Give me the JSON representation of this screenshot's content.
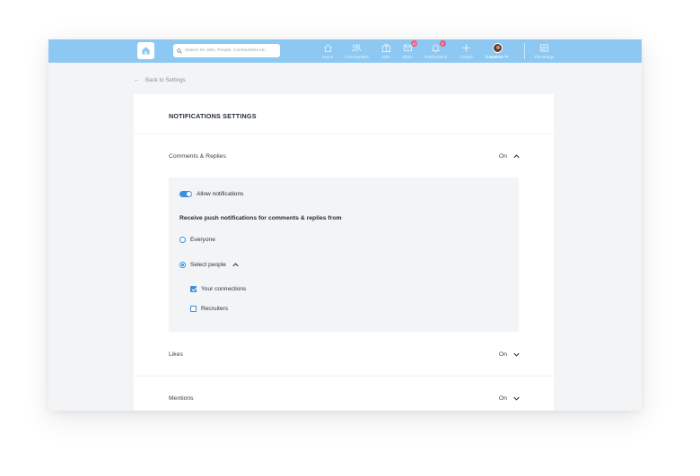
{
  "topbar": {
    "search": {
      "placeholder": "Search for Jobs, People, Communities etc."
    },
    "nav": [
      {
        "label": "Home",
        "icon": "home-icon"
      },
      {
        "label": "Communities",
        "icon": "communities-icon"
      },
      {
        "label": "Jobs",
        "icon": "jobs-icon"
      },
      {
        "label": "Inbox",
        "icon": "inbox-icon",
        "badge": "10"
      },
      {
        "label": "Notifications",
        "icon": "bell-icon",
        "badge": "3"
      },
      {
        "label": "Create",
        "icon": "plus-icon"
      },
      {
        "label": "Cameron",
        "icon": "avatar"
      },
      {
        "label": "The Bridge",
        "icon": "bridge-icon"
      }
    ],
    "colors": {
      "bar": "#8cc8f2",
      "badge": "#f05a7e"
    }
  },
  "back_link": {
    "label": "Back to Settings"
  },
  "settings": {
    "title": "NOTIFICATIONS SETTINGS",
    "sections": [
      {
        "label": "Comments & Replies",
        "state": "On",
        "expanded": true
      },
      {
        "label": "Likes",
        "state": "On",
        "expanded": false
      },
      {
        "label": "Mentions",
        "state": "On",
        "expanded": false
      }
    ],
    "panel": {
      "toggle_label": "Allow notifications",
      "toggle_on": true,
      "heading": "Receive push notifications for comments & replies from",
      "options": [
        {
          "label": "Everyone",
          "checked": false
        },
        {
          "label": "Select people",
          "checked": true
        }
      ],
      "sub_options": [
        {
          "label": "Your connections",
          "checked": true
        },
        {
          "label": "Recruiters",
          "checked": false
        }
      ]
    },
    "accent": "#3b8fdc"
  }
}
